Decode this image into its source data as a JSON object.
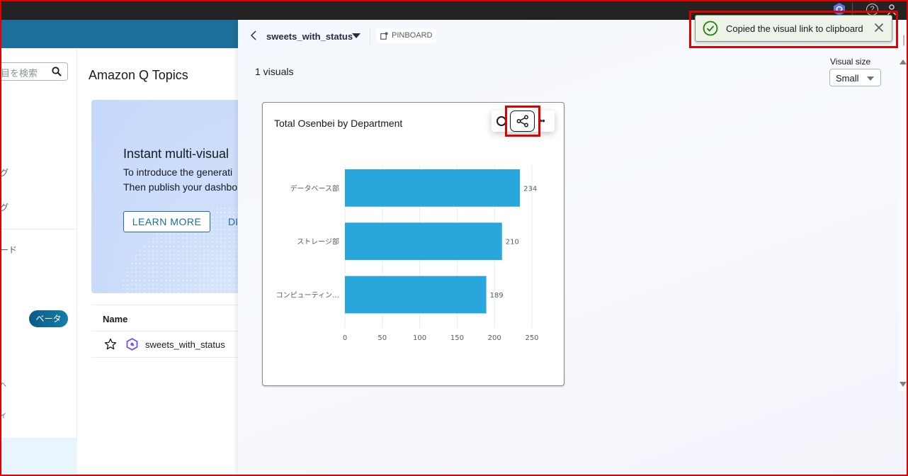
{
  "topbar": {
    "icons": [
      "amazon-q-icon",
      "help-icon",
      "user-icon"
    ]
  },
  "sidebar": {
    "search_placeholder": "項目を検索",
    "search_placeholder_visible": "目を検索",
    "fragments": [
      "グ",
      "グ",
      "ード",
      "へ",
      "イ"
    ],
    "beta_badge": "ベータ"
  },
  "main": {
    "title": "Amazon Q Topics",
    "promo": {
      "heading": "Instant multi-visual",
      "line1": "To introduce the generati",
      "line2": "Then publish your dashbo",
      "learn_more": "LEARN MORE",
      "dismiss": "DI"
    },
    "table": {
      "column_name": "Name",
      "rows": [
        {
          "name": "sweets_with_status",
          "starred": false
        }
      ]
    }
  },
  "panel": {
    "topic": "sweets_with_status",
    "pinboard_label": "PINBOARD",
    "visual_count": "1 visuals",
    "visual_size_label": "Visual size",
    "visual_size_value": "Small"
  },
  "toast": {
    "message": "Copied the visual link to clipboard",
    "status": "success",
    "color": "#1d8102"
  },
  "card": {
    "title": "Total Osenbei by Department",
    "tools": [
      "explore-icon",
      "share-icon",
      "more-icon"
    ]
  },
  "colors": {
    "bar": "#29a6db",
    "accent": "#1b6f9a",
    "highlight": "#e00000"
  },
  "chart_data": {
    "type": "bar",
    "orientation": "horizontal",
    "title": "Total Osenbei by Department",
    "categories": [
      "データベース部",
      "ストレージ部",
      "コンピューティン…"
    ],
    "values": [
      234,
      210,
      189
    ],
    "data_labels": [
      "234",
      "210",
      "189"
    ],
    "xlabel": "",
    "ylabel": "",
    "xlim": [
      0,
      250
    ],
    "xticks": [
      0,
      50,
      100,
      150,
      200,
      250
    ],
    "grid": true,
    "legend": "none"
  }
}
